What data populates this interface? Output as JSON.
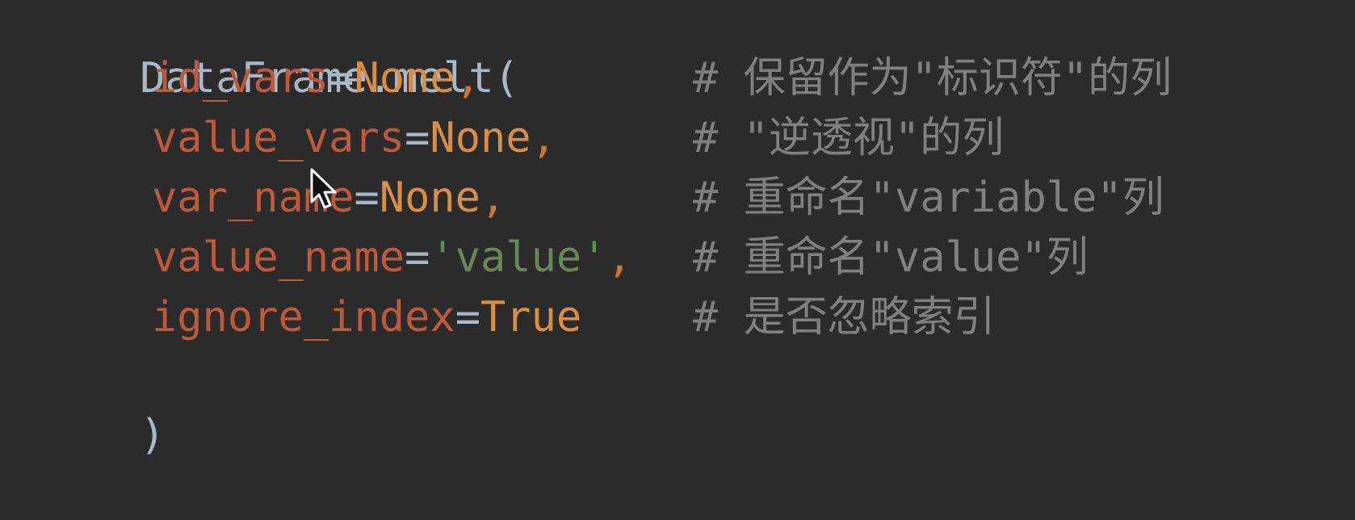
{
  "code": {
    "line1": {
      "text": "DataFrame.melt("
    },
    "line2": {
      "param": "id_vars",
      "op": "=",
      "value": "None",
      "sep": ",",
      "comment": "# 保留作为\"标识符\"的列"
    },
    "line3": {
      "param": "value_vars",
      "op": "=",
      "value": "None",
      "sep": ",",
      "comment": "# \"逆透视\"的列"
    },
    "line4": {
      "param": "var_name",
      "op": "=",
      "value": "None",
      "sep": ",",
      "comment": "# 重命名\"variable\"列"
    },
    "line5": {
      "param": "value_name",
      "op": "=",
      "value": "'value'",
      "sep": ",",
      "comment": "# 重命名\"value\"列"
    },
    "line6": {
      "param": "ignore_index",
      "op": "=",
      "value": "True",
      "sep": "",
      "comment": "# 是否忽略索引"
    },
    "line7": {
      "text": ")"
    }
  },
  "colors": {
    "background": "#2b2b2b",
    "identifier": "#a9b7c6",
    "parameter": "#c0583a",
    "constant": "#d98e45",
    "string": "#6a8759",
    "comment": "#808080"
  },
  "icons": {
    "cursor": "mouse-pointer-arrow-icon"
  }
}
